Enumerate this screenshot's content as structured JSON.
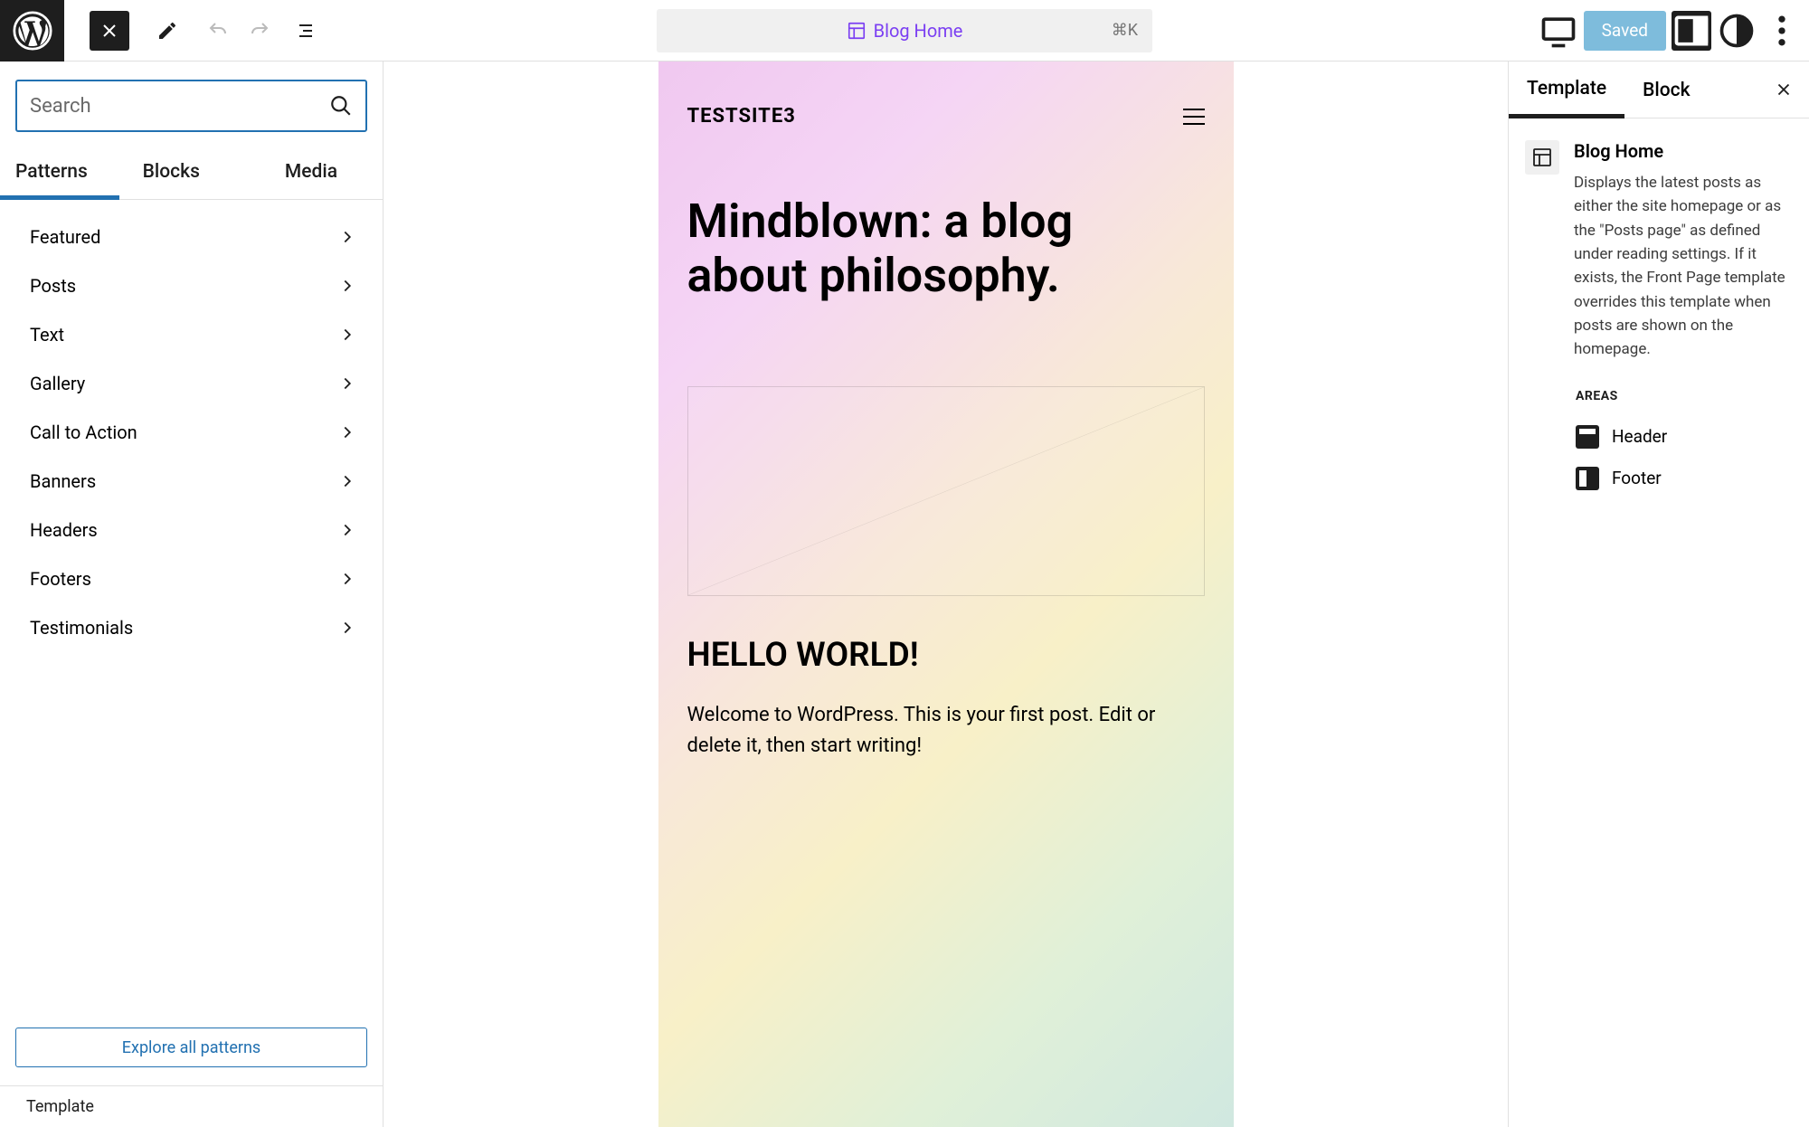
{
  "topbar": {
    "page_title": "Blog Home",
    "shortcut": "⌘K",
    "saved_label": "Saved"
  },
  "left": {
    "search_placeholder": "Search",
    "tabs": [
      "Patterns",
      "Blocks",
      "Media"
    ],
    "categories": [
      "Featured",
      "Posts",
      "Text",
      "Gallery",
      "Call to Action",
      "Banners",
      "Headers",
      "Footers",
      "Testimonials"
    ],
    "explore_label": "Explore all patterns",
    "breadcrumb": "Template"
  },
  "canvas": {
    "site_title": "TESTSITE3",
    "heading": "Mindblown: a blog about philosophy.",
    "post_title": "HELLO WORLD!",
    "post_body": "Welcome to WordPress. This is your first post. Edit or delete it, then start writing!"
  },
  "right": {
    "tabs": [
      "Template",
      "Block"
    ],
    "template_name": "Blog Home",
    "template_desc": "Displays the latest posts as either the site homepage or as the \"Posts page\" as defined under reading settings. If it exists, the Front Page template overrides this template when posts are shown on the homepage.",
    "areas_label": "AREAS",
    "areas": [
      "Header",
      "Footer"
    ]
  }
}
